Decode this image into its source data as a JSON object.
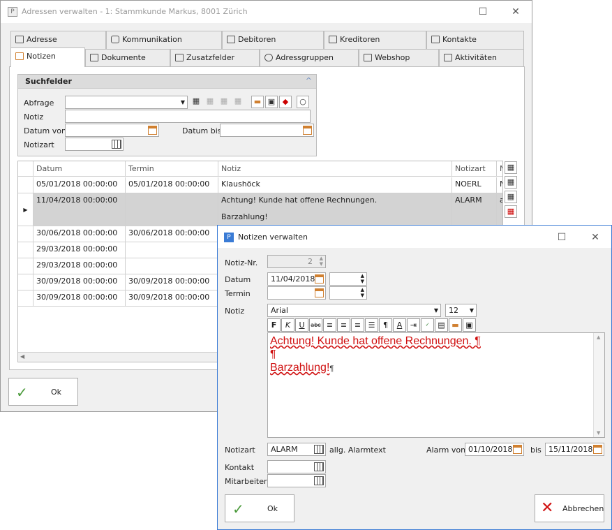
{
  "main_window": {
    "title": "Adressen verwalten - 1: Stammkunde Markus, 8001 Zürich",
    "tabs_row1": [
      "Adresse",
      "Kommunikation",
      "Debitoren",
      "Kreditoren",
      "Kontakte"
    ],
    "tabs_row2": [
      "Notizen",
      "Dokumente",
      "Zusatzfelder",
      "Adressgruppen",
      "Webshop",
      "Aktivitäten"
    ],
    "search": {
      "header": "Suchfelder",
      "abfrage_label": "Abfrage",
      "notiz_label": "Notiz",
      "datum_von_label": "Datum von",
      "datum_bis_label": "Datum bis",
      "notizart_label": "Notizart"
    },
    "grid": {
      "columns": [
        "Datum",
        "Termin",
        "Notiz",
        "Notizart",
        "N"
      ],
      "rows": [
        {
          "datum": "05/01/2018 00:00:00",
          "termin": "05/01/2018 00:00:00",
          "notiz": "Klaushöck",
          "notizart": "NOERL",
          "n": "N"
        },
        {
          "datum": "11/04/2018 00:00:00",
          "termin": "",
          "notiz": "Achtung! Kunde hat offene Rechnungen.",
          "notiz2": "Barzahlung!",
          "notizart": "ALARM",
          "n": "a"
        },
        {
          "datum": "30/06/2018 00:00:00",
          "termin": "30/06/2018 00:00:00",
          "notiz": "",
          "notizart": "",
          "n": ""
        },
        {
          "datum": "29/03/2018 00:00:00",
          "termin": "",
          "notiz": "",
          "notizart": "",
          "n": ""
        },
        {
          "datum": "29/03/2018 00:00:00",
          "termin": "",
          "notiz": "",
          "notizart": "",
          "n": ""
        },
        {
          "datum": "30/09/2018 00:00:00",
          "termin": "30/09/2018 00:00:00",
          "notiz": "",
          "notizart": "",
          "n": ""
        },
        {
          "datum": "30/09/2018 00:00:00",
          "termin": "30/09/2018 00:00:00",
          "notiz": "",
          "notizart": "",
          "n": ""
        }
      ]
    },
    "ok_label": "Ok"
  },
  "dialog": {
    "title": "Notizen verwalten",
    "notiz_nr_label": "Notiz-Nr.",
    "notiz_nr_value": "2",
    "datum_label": "Datum",
    "datum_value": "11/04/2018",
    "termin_label": "Termin",
    "notiz_label": "Notiz",
    "font_name": "Arial",
    "font_size": "12",
    "editor_line1": "Achtung! Kunde hat offene Rechnungen. ¶",
    "editor_line2": "¶",
    "editor_line3": "Barzahlung!",
    "pilcrow": "¶",
    "notizart_label": "Notizart",
    "notizart_value": "ALARM",
    "alarmtext_label": "allg. Alarmtext",
    "alarm_von_label": "Alarm von",
    "alarm_von_value": "01/10/2018",
    "bis_label": "bis",
    "bis_value": "15/11/2018",
    "kontakt_label": "Kontakt",
    "mitarbeiter_label": "Mitarbeiter",
    "ok_label": "Ok",
    "cancel_label": "Abbrechen"
  }
}
